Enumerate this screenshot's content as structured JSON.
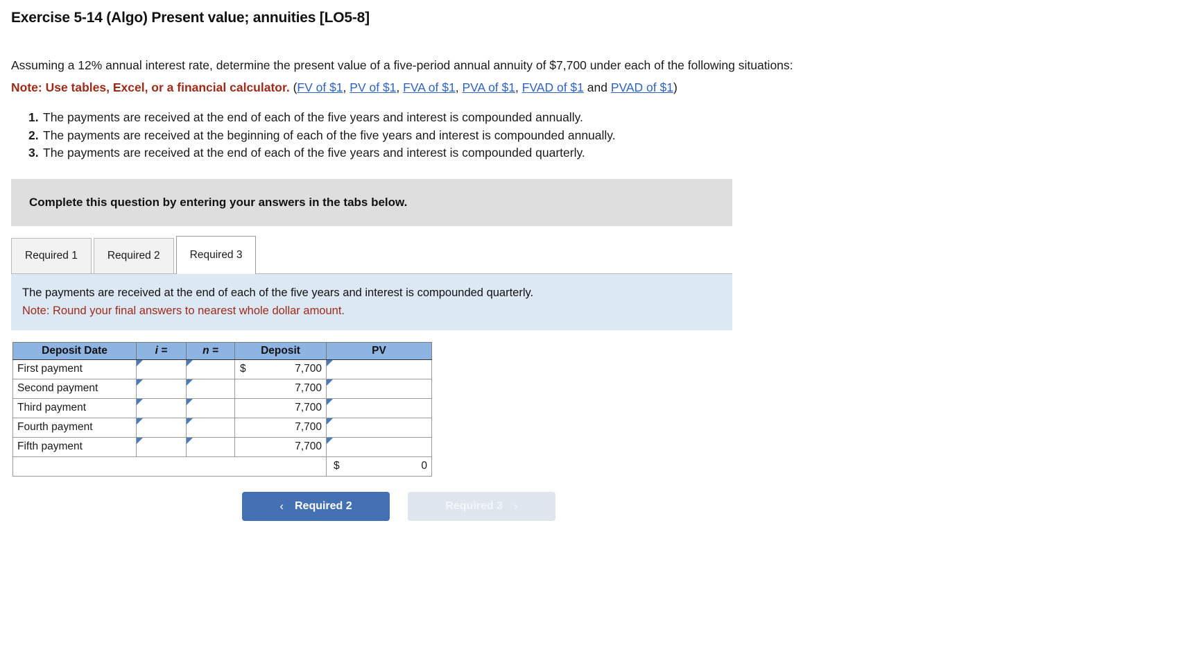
{
  "exercise": {
    "title": "Exercise 5-14 (Algo) Present value; annuities [LO5-8]",
    "intro": "Assuming a 12% annual interest rate, determine the present value of a five-period annual annuity of $7,700 under each of the following situations:",
    "note_label": "Note: Use tables, Excel, or a financial calculator.",
    "paren_open": "(",
    "paren_close": ")",
    "and_word": " and ",
    "comma": ", ",
    "links": [
      {
        "label": "FV of $1"
      },
      {
        "label": "PV of $1"
      },
      {
        "label": "FVA of $1"
      },
      {
        "label": "PVA of $1"
      },
      {
        "label": "FVAD of $1"
      },
      {
        "label": "PVAD of $1"
      }
    ],
    "situations": [
      {
        "num": "1.",
        "text": "The payments are received at the end of each of the five years and interest is compounded annually."
      },
      {
        "num": "2.",
        "text": "The payments are received at the beginning of each of the five years and interest is compounded annually."
      },
      {
        "num": "3.",
        "text": "The payments are received at the end of each of the five years and interest is compounded quarterly."
      }
    ]
  },
  "complete_bar": {
    "text": "Complete this question by entering your answers in the tabs below."
  },
  "tabs": [
    {
      "label": "Required 1",
      "active": false
    },
    {
      "label": "Required 2",
      "active": false
    },
    {
      "label": "Required 3",
      "active": true
    }
  ],
  "panel": {
    "instruction": "The payments are received at the end of each of the five years and interest is compounded quarterly.",
    "rounding_note": "Note: Round your final answers to nearest whole dollar amount."
  },
  "table": {
    "headers": [
      "Deposit Date",
      "i =",
      "n =",
      "Deposit",
      "PV"
    ],
    "rows": [
      {
        "date": "First payment",
        "i": "",
        "n": "",
        "dollar": "$",
        "deposit": "7,700",
        "pv": ""
      },
      {
        "date": "Second payment",
        "i": "",
        "n": "",
        "dollar": "",
        "deposit": "7,700",
        "pv": ""
      },
      {
        "date": "Third payment",
        "i": "",
        "n": "",
        "dollar": "",
        "deposit": "7,700",
        "pv": ""
      },
      {
        "date": "Fourth payment",
        "i": "",
        "n": "",
        "dollar": "",
        "deposit": "7,700",
        "pv": ""
      },
      {
        "date": "Fifth payment",
        "i": "",
        "n": "",
        "dollar": "",
        "deposit": "7,700",
        "pv": ""
      }
    ],
    "total": {
      "dollar": "$",
      "value": "0"
    }
  },
  "nav": {
    "prev_label": "Required 2",
    "prev_chevron": "‹",
    "next_label": "Required 3",
    "next_chevron": "›"
  },
  "colors": {
    "header_blue": "#8eb4e3",
    "input_border": "#5b86c4",
    "panel_blue": "#dde8f5",
    "bar_gray": "#dedede",
    "note_red": "#9e2a17",
    "link_blue": "#2f62c4",
    "total_yellow": "#fbf8b8",
    "btn_active": "#4471b4",
    "btn_disabled": "#dfe6ee"
  }
}
